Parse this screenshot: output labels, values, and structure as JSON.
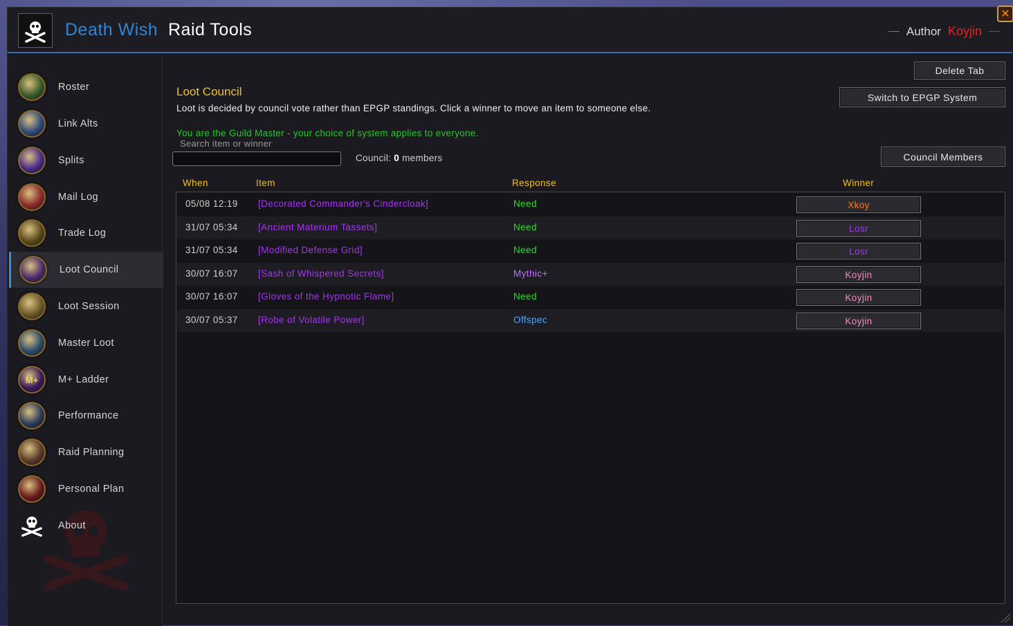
{
  "header": {
    "title_part1": "Death Wish",
    "title_part2": "Raid Tools",
    "author_label": "Author",
    "author_name": "Koyjin",
    "close_symbol": "✕"
  },
  "sidebar": {
    "items": [
      {
        "label": "Roster",
        "icon": "roster-icon",
        "color": "#3b5a2a"
      },
      {
        "label": "Link Alts",
        "icon": "link-alts-icon",
        "color": "#2f4a7a"
      },
      {
        "label": "Splits",
        "icon": "splits-icon",
        "color": "#4a2a8a"
      },
      {
        "label": "Mail Log",
        "icon": "mail-icon",
        "color": "#8a2a2a"
      },
      {
        "label": "Trade Log",
        "icon": "trade-icon",
        "color": "#5a4a1a"
      },
      {
        "label": "Loot Council",
        "icon": "loot-council-icon",
        "color": "#4a2a6a"
      },
      {
        "label": "Loot Session",
        "icon": "loot-session-icon",
        "color": "#6a5a2a"
      },
      {
        "label": "Master Loot",
        "icon": "master-loot-icon",
        "color": "#2a4a6a"
      },
      {
        "label": "M+ Ladder",
        "icon": "mplus-icon",
        "color": "#3a1a5a"
      },
      {
        "label": "Performance",
        "icon": "performance-icon",
        "color": "#2a3a5a"
      },
      {
        "label": "Raid Planning",
        "icon": "raid-planning-icon",
        "color": "#5a3a2a"
      },
      {
        "label": "Personal Plan",
        "icon": "personal-plan-icon",
        "color": "#6a1a1a"
      },
      {
        "label": "About",
        "icon": "skull-icon",
        "color": "#1b1a20"
      }
    ],
    "active_index": 5
  },
  "main": {
    "delete_tab": "Delete Tab",
    "switch_system": "Switch to EPGP System",
    "council_members_button": "Council Members",
    "title": "Loot Council",
    "description": "Loot is decided by council vote rather than EPGP standings. Click a winner to move an item to someone else.",
    "gm_note": "You are the Guild Master - your choice of system applies to everyone.",
    "search_placeholder": "Search item or winner",
    "search_value": "",
    "council_prefix": "Council:",
    "council_count": "0",
    "council_suffix": "members",
    "columns": {
      "when": "When",
      "item": "Item",
      "response": "Response",
      "winner": "Winner"
    }
  },
  "rows": [
    {
      "when": "05/08 12:19",
      "item": "[Decorated Commander's Cindercloak]",
      "response": "Need",
      "response_color": "#1ee61e",
      "winner": "Xkoy",
      "winner_color": "#ff7c0a"
    },
    {
      "when": "31/07 05:34",
      "item": "[Ancient Materium Tassets]",
      "response": "Need",
      "response_color": "#1ee61e",
      "winner": "Losr",
      "winner_color": "#a335ee"
    },
    {
      "when": "31/07 05:34",
      "item": "[Modified Defense Grid]",
      "response": "Need",
      "response_color": "#1ee61e",
      "winner": "Losr",
      "winner_color": "#a335ee"
    },
    {
      "when": "30/07 16:07",
      "item": "[Sash of Whispered Secrets]",
      "response": "Mythic+",
      "response_color": "#c070ff",
      "winner": "Koyjin",
      "winner_color": "#f48cba"
    },
    {
      "when": "30/07 16:07",
      "item": "[Gloves of the Hypnotic Flame]",
      "response": "Need",
      "response_color": "#1ee61e",
      "winner": "Koyjin",
      "winner_color": "#f48cba"
    },
    {
      "when": "30/07 05:37",
      "item": "[Robe of Volatile Power]",
      "response": "Offspec",
      "response_color": "#4aa8ff",
      "winner": "Koyjin",
      "winner_color": "#f48cba"
    }
  ]
}
